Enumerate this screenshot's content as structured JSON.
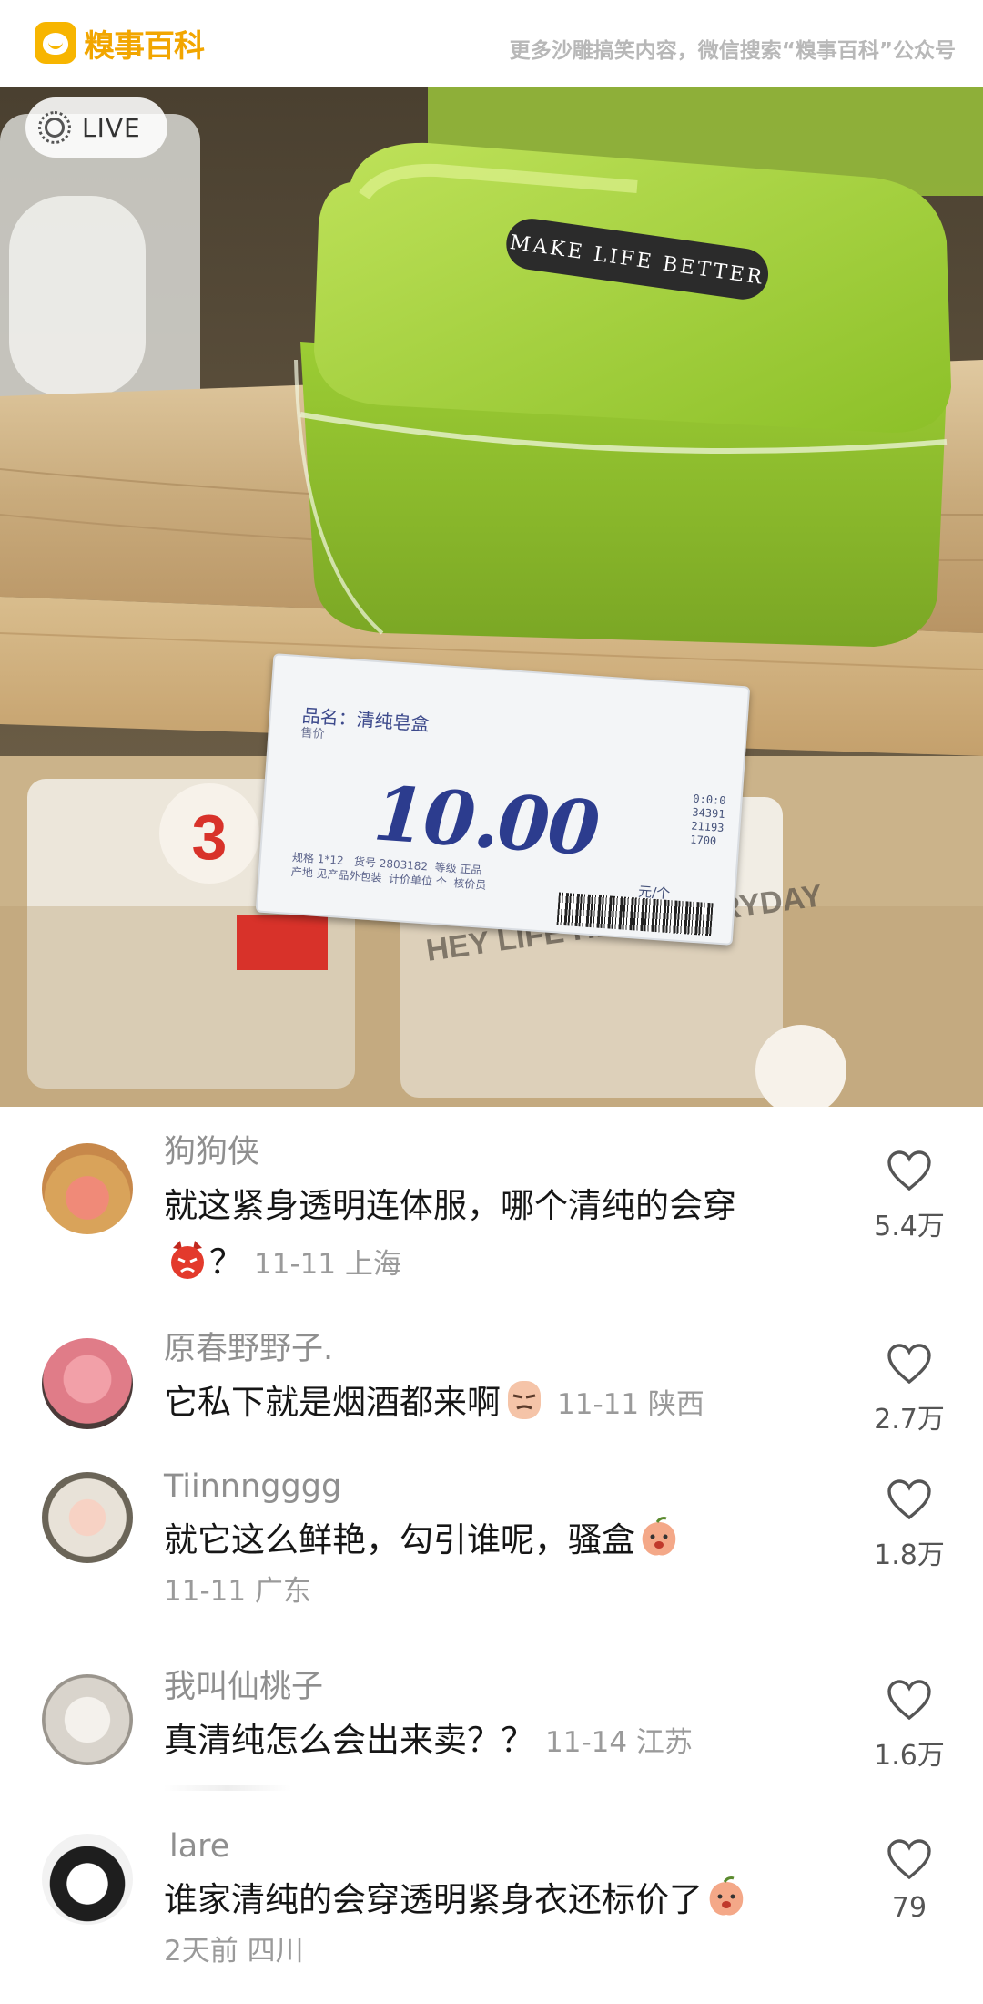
{
  "watermark": {
    "brand": "糗事百科",
    "promo": "更多沙雕搞笑内容，微信搜索“糗事百科”公众号"
  },
  "photo": {
    "live_label": "LIVE",
    "box_label": "MAKE LIFE BETTER",
    "price_tag": {
      "name": "品名：清纯皂盒",
      "sub": "售价",
      "price": "10.00",
      "codes": "0:0:0\n34391\n21193\n1700",
      "unit": "元/个",
      "meta": "规格 1*12   货号 2803182  等级 正品\n产地 见产品外包装  计价单位 个  核价员"
    },
    "background_sign": "HEY LIFE HIGH EVERYDAY"
  },
  "comments": [
    {
      "user": "狗狗侠",
      "text": "就这紧身透明连体服，哪个清纯的会穿",
      "text_tail": "？",
      "emoji": "angry-emoji",
      "meta": "11-11 上海",
      "likes": "5.4万"
    },
    {
      "user": "原春野野子.",
      "text": "它私下就是烟酒都来啊",
      "emoji": "smirk-emoji",
      "meta": "11-11 陕西",
      "likes": "2.7万"
    },
    {
      "user": "Tiinnngggg",
      "text": "就它这么鲜艳，勾引谁呢，骚盒",
      "emoji": "peach-emoji",
      "meta": "11-11 广东",
      "likes": "1.8万"
    },
    {
      "user": "我叫仙桃子",
      "text": "真清纯怎么会出来卖？？",
      "meta": "11-14 江苏",
      "likes": "1.6万"
    },
    {
      "user": "lare",
      "text": "谁家清纯的会穿透明紧身衣还标价了",
      "emoji": "peach-emoji",
      "meta": "2天前 四川",
      "likes": "79"
    }
  ],
  "colors": {
    "brand": "#f2a600",
    "soap_box": "#a9d63a",
    "price_text": "#2c3c8e"
  }
}
